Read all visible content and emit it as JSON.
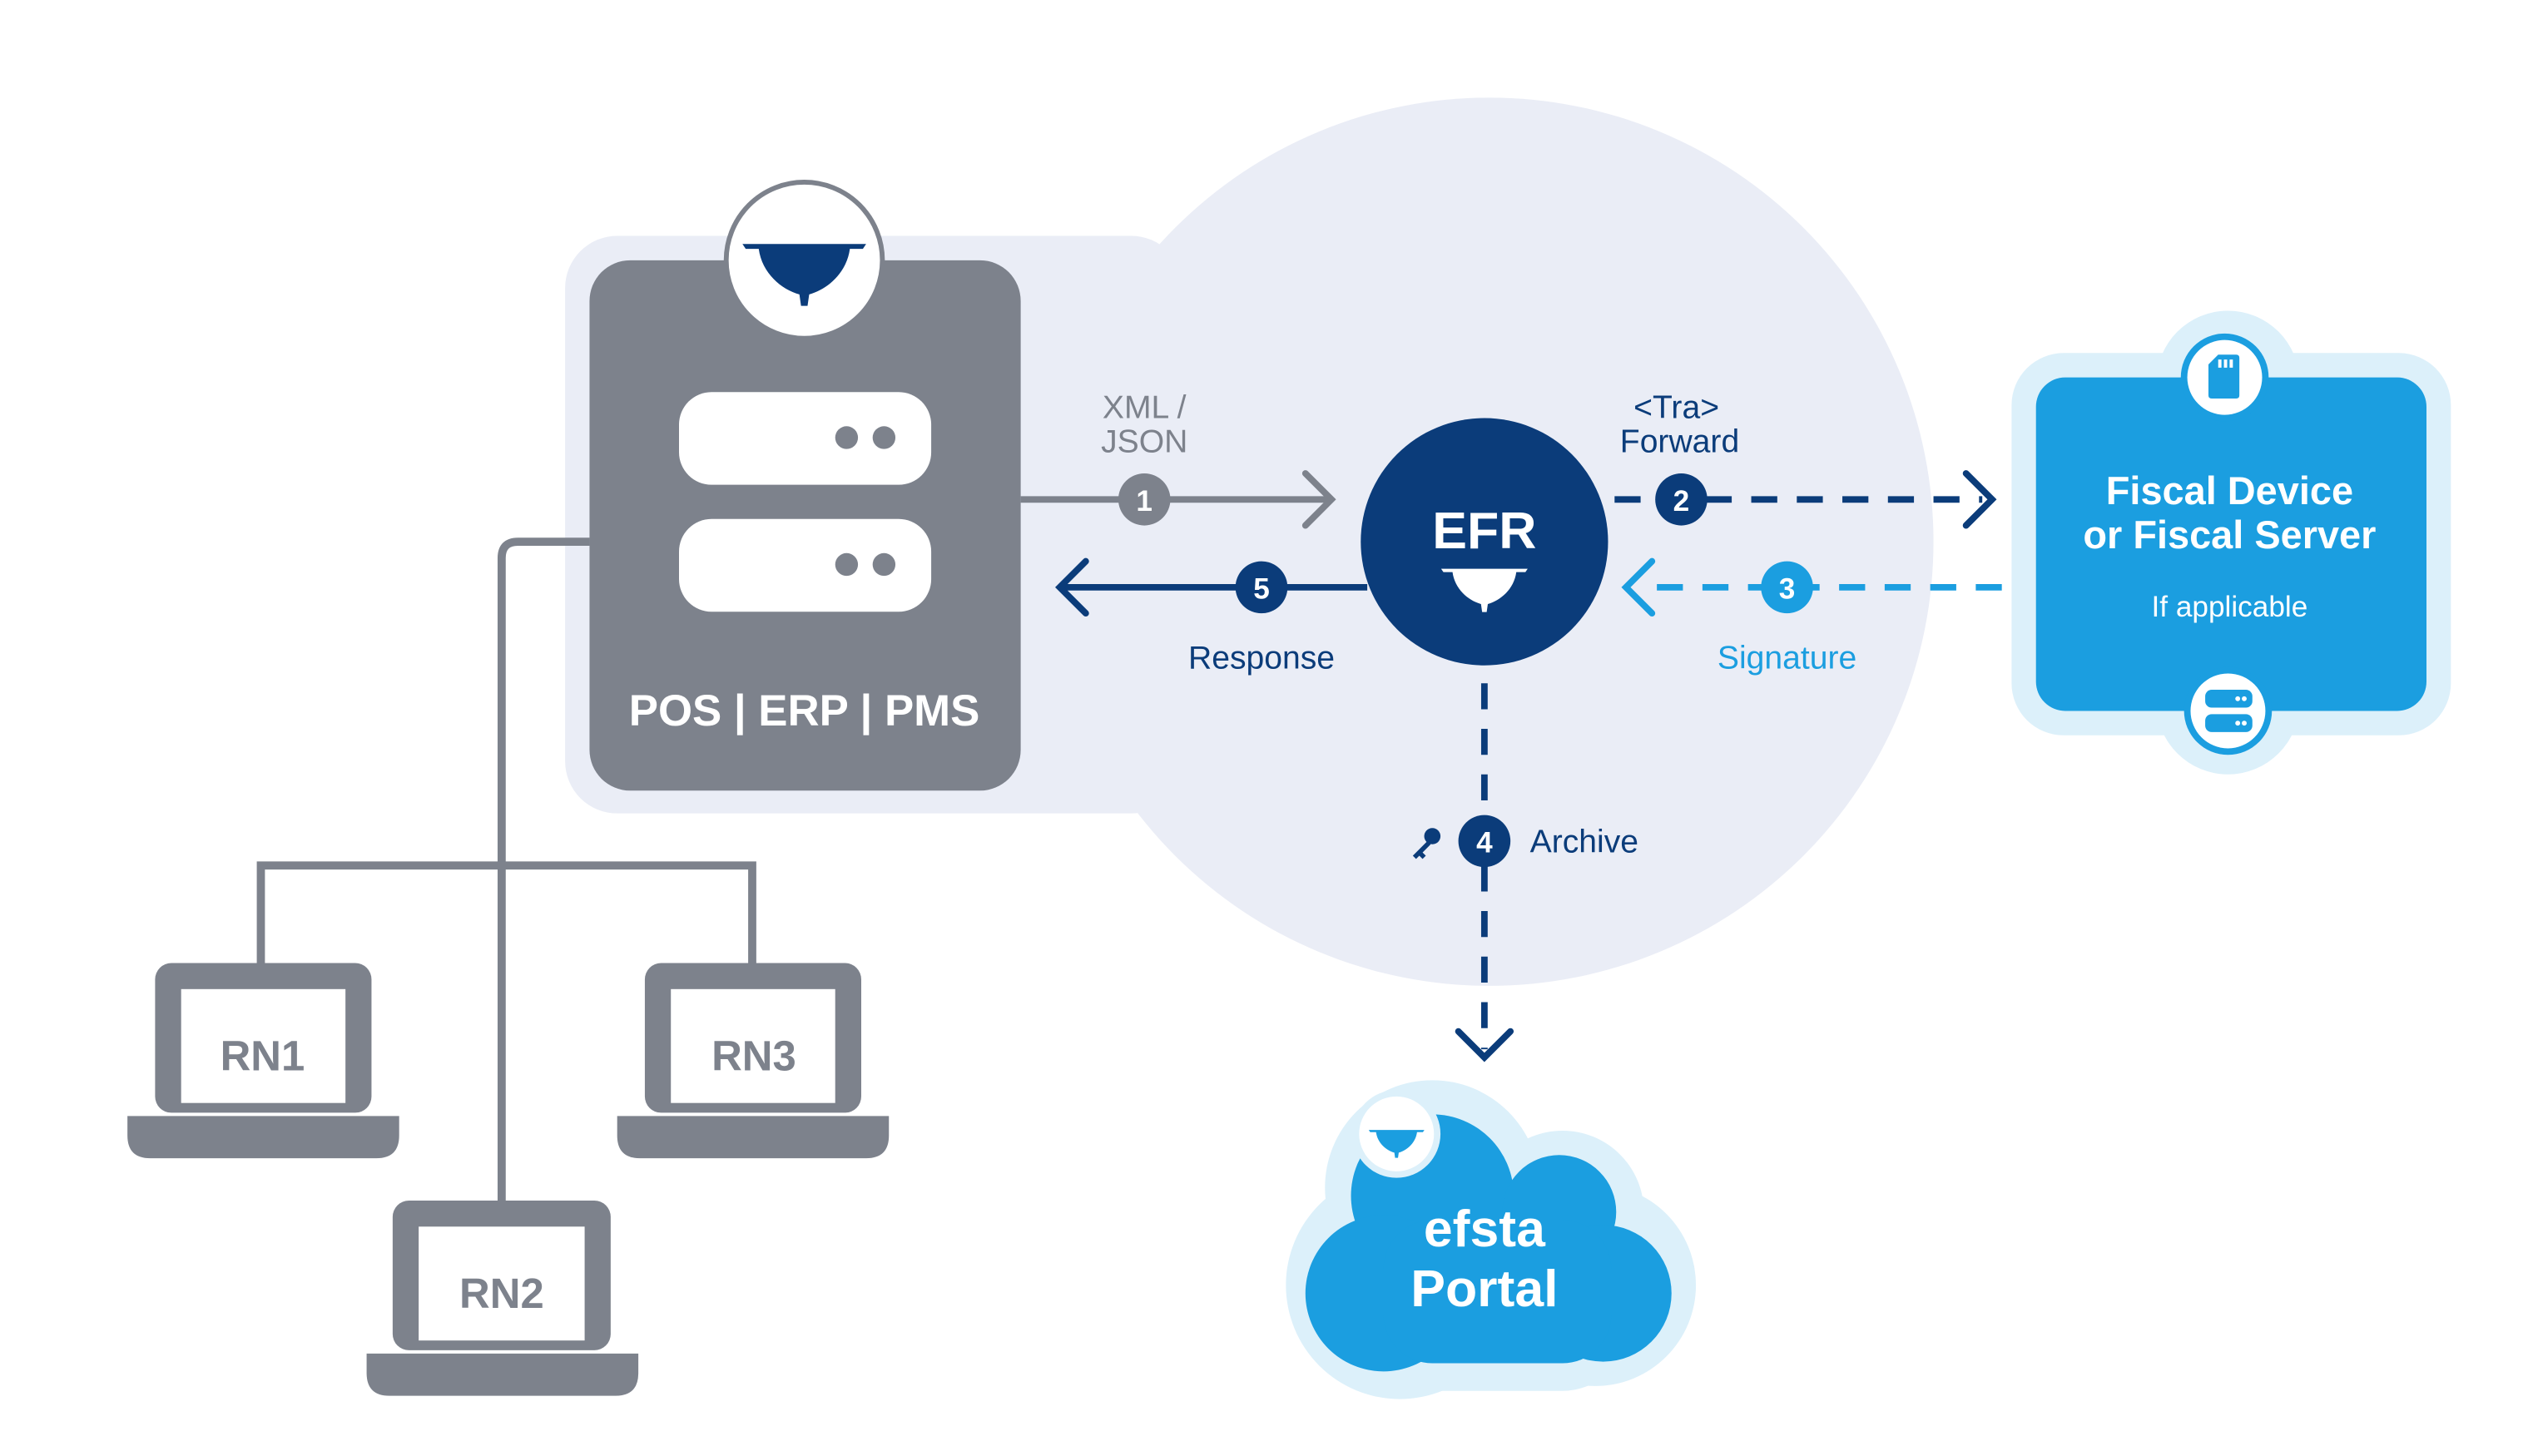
{
  "colors": {
    "navy": "#0b3c7a",
    "blue": "#1b9ee0",
    "gray": "#7d828c",
    "bg_circle": "#eaedf6",
    "light_blue": "#dcf0fa"
  },
  "pos": {
    "label": "POS | ERP | PMS",
    "logo_icon": "efsta-wing-logo-icon",
    "server_icon": "server-icon"
  },
  "terminals": [
    {
      "label": "RN1"
    },
    {
      "label": "RN2"
    },
    {
      "label": "RN3"
    }
  ],
  "efr": {
    "label": "EFR",
    "logo_icon": "efsta-wing-logo-icon"
  },
  "steps": [
    {
      "number": "1",
      "label_lines": [
        "XML /",
        "JSON"
      ]
    },
    {
      "number": "2",
      "label_lines": [
        "<Tra>",
        "Forward"
      ]
    },
    {
      "number": "3",
      "label": "Signature"
    },
    {
      "number": "4",
      "label": "Archive",
      "icon": "key-icon"
    },
    {
      "number": "5",
      "label": "Response"
    }
  ],
  "fiscal": {
    "title_lines": [
      "Fiscal Device",
      "or Fiscal Server"
    ],
    "subtitle": "If applicable",
    "top_icon": "sd-card-icon",
    "bottom_icon": "server-icon"
  },
  "portal": {
    "lines": [
      "efsta",
      "Portal"
    ],
    "logo_icon": "efsta-wing-logo-icon"
  }
}
